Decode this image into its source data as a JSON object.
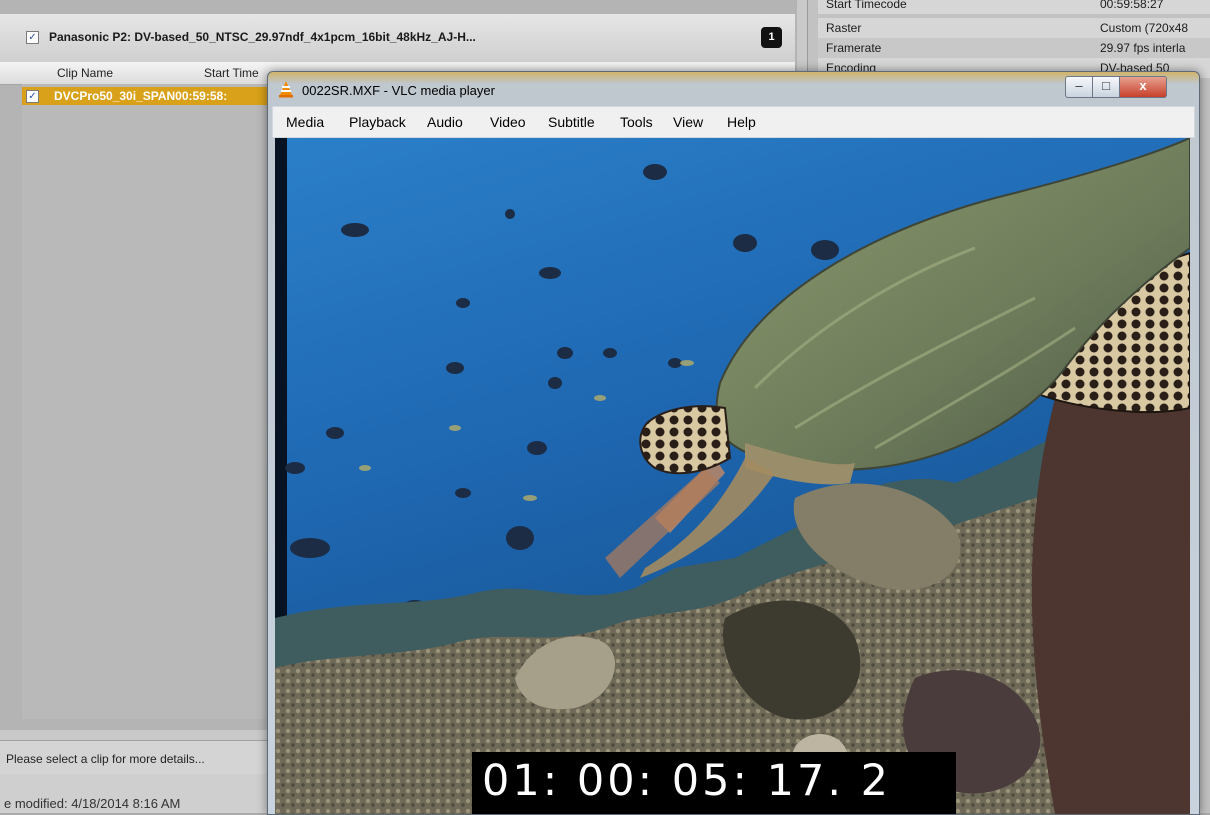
{
  "background_app": {
    "group_title": "Panasonic P2: DV-based_50_NTSC_29.97ndf_4x1pcm_16bit_48kHz_AJ-H...",
    "group_count": "1",
    "columns": [
      "Clip Name",
      "Start Time"
    ],
    "clip_row": "DVCPro50_30i_SPAN00:59:58:",
    "status_text": "Please select a clip for more details...",
    "modified_text": "e modified: 4/18/2014 8:16 AM",
    "properties": [
      {
        "key": "Start Timecode",
        "value": "00:59:58:27"
      },
      {
        "key": "Raster",
        "value": "Custom (720x48"
      },
      {
        "key": "Framerate",
        "value": "29.97 fps interla"
      },
      {
        "key": "Encoding",
        "value": "DV-based 50"
      }
    ]
  },
  "vlc": {
    "title": "0022SR.MXF - VLC media player",
    "menu": [
      "Media",
      "Playback",
      "Audio",
      "Video",
      "Subtitle",
      "Tools",
      "View",
      "Help"
    ],
    "window_buttons": {
      "minimize": "–",
      "maximize": "□",
      "close": "x"
    },
    "timecode": "01: 00: 05: 17. 2"
  }
}
